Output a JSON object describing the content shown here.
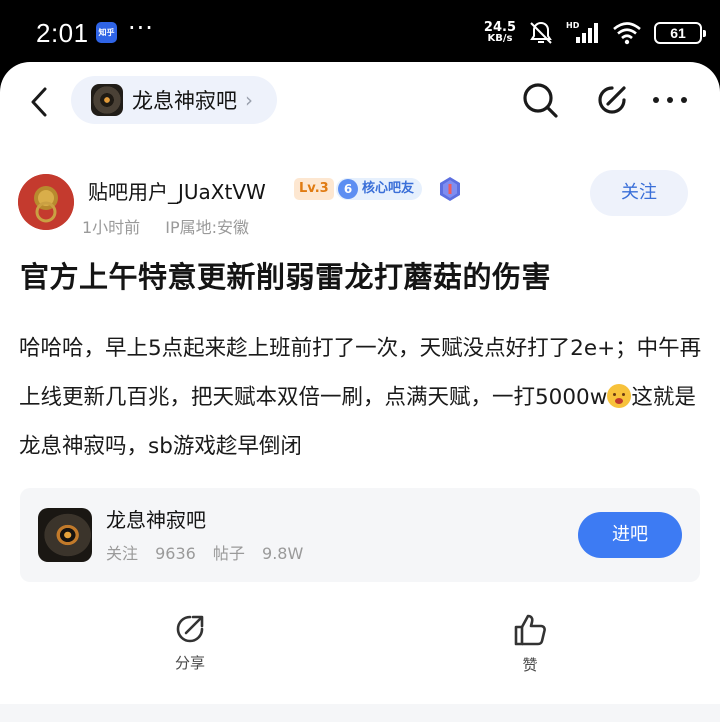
{
  "status_bar": {
    "time": "2:01",
    "app_badge": "知乎",
    "more": "···",
    "net_speed_value": "24.5",
    "net_speed_unit": "KB/s",
    "battery": "61"
  },
  "nav": {
    "forum_name": "龙息神寂吧",
    "chevron": "›"
  },
  "author": {
    "name": "贴吧用户_JUaXtVW",
    "level": "Lv.3",
    "core_badge_num": "6",
    "core_badge_label": "核心吧友",
    "time_ago": "1小时前",
    "ip_location": "IP属地:安徽",
    "follow_label": "关注"
  },
  "post": {
    "title": "官方上午特意更新削弱雷龙打蘑菇的伤害",
    "body_before_emoji": "哈哈哈，早上5点起来趁上班前打了一次，天赋没点好打了2e+；中午再上线更新几百兆，把天赋本双倍一刷，点满天赋，一打5000w",
    "body_after_emoji": "这就是龙息神寂吗，sb游戏趁早倒闭"
  },
  "forum_card": {
    "name": "龙息神寂吧",
    "followers_label": "关注",
    "followers": "9636",
    "posts_label": "帖子",
    "posts": "9.8W",
    "enter_label": "进吧"
  },
  "actions": {
    "share_label": "分享",
    "like_label": "赞"
  },
  "colors": {
    "accent": "#3d7bf3",
    "pill_bg": "#eef2fb"
  }
}
